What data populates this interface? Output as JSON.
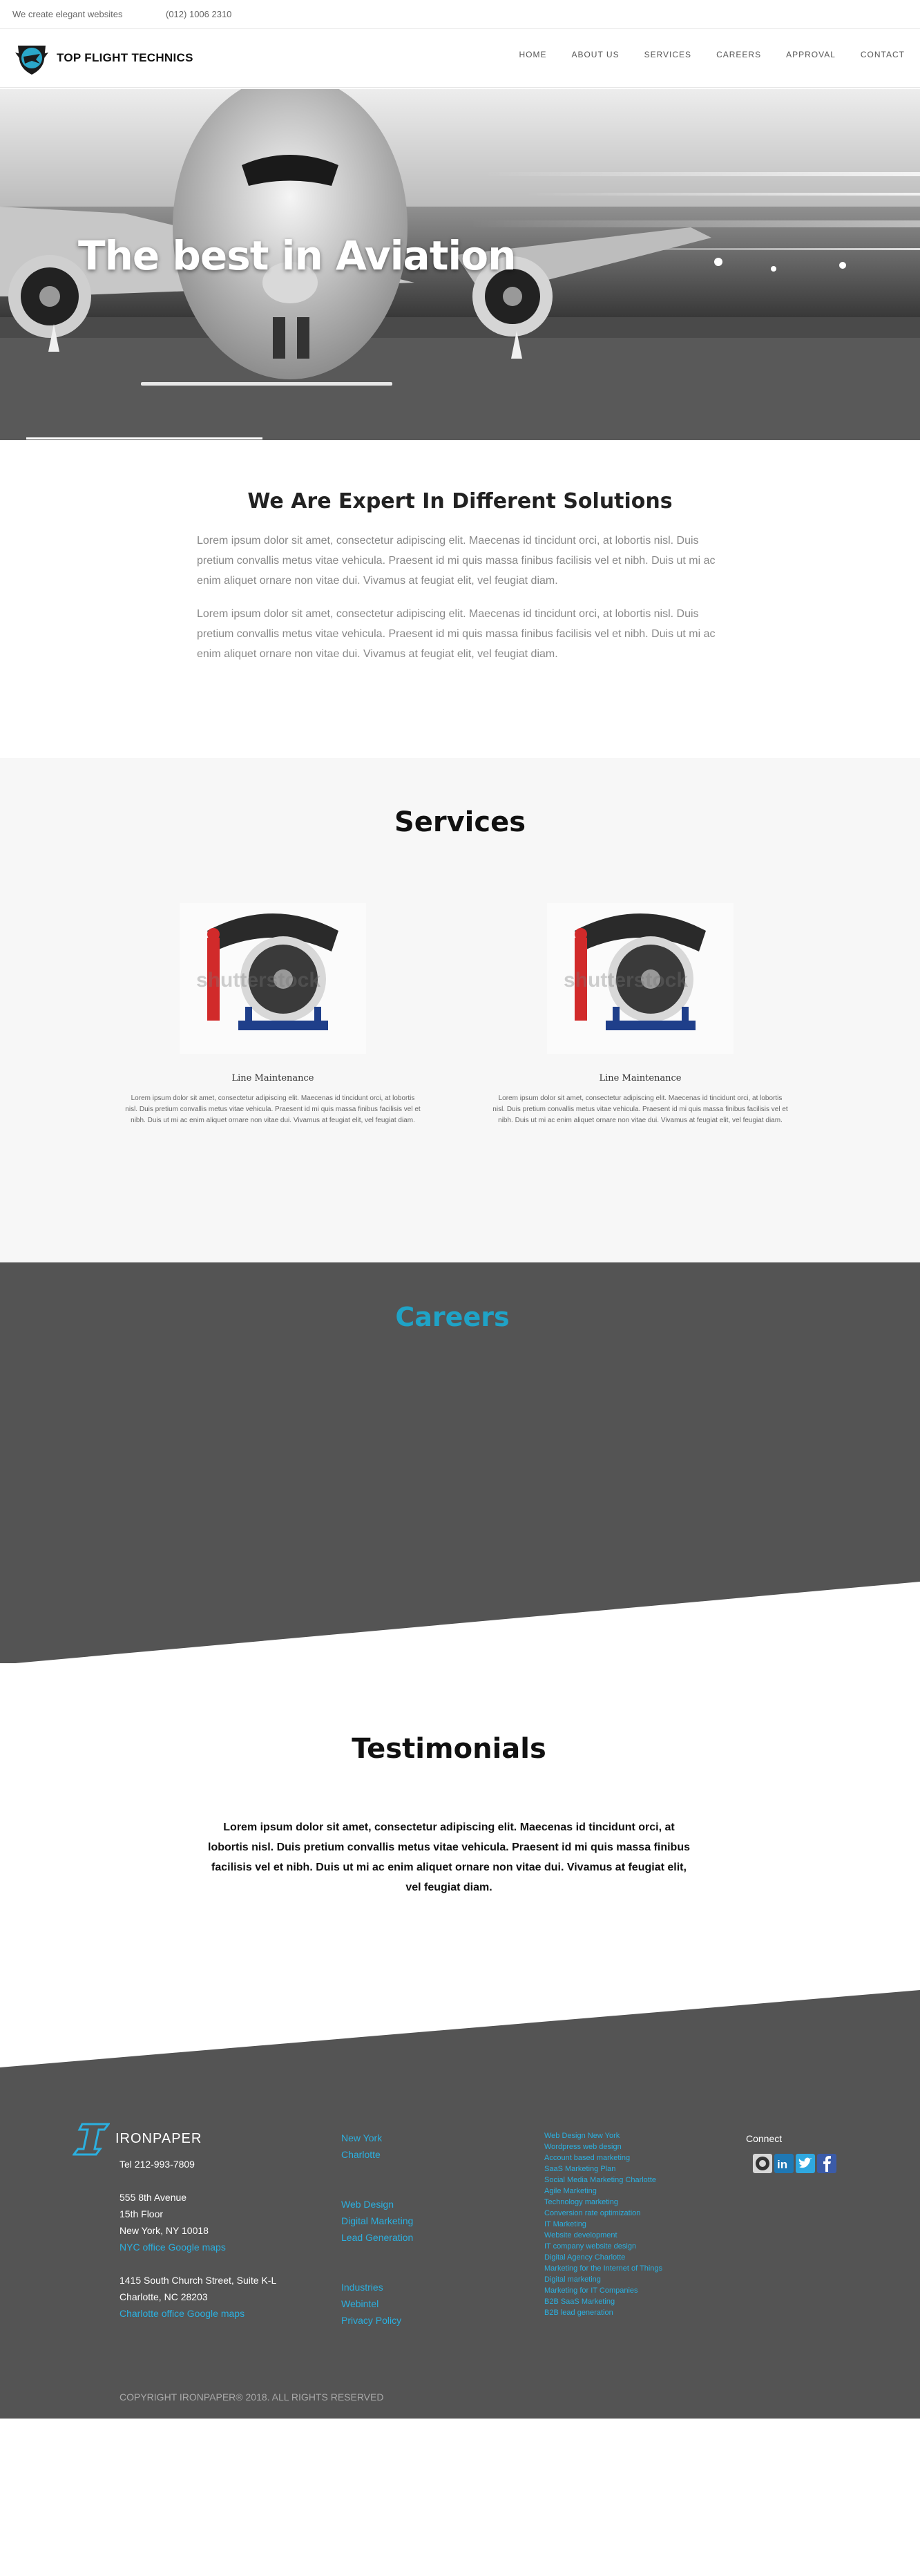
{
  "topbar": {
    "tagline": "We create elegant websites",
    "phone": "(012) 1006 2310"
  },
  "brand": {
    "name": "TOP FLIGHT TECHNICS"
  },
  "nav": {
    "items": [
      "HOME",
      "ABOUT US",
      "SERVICES",
      "CAREERS",
      "APPROVAL",
      "CONTACT"
    ]
  },
  "hero": {
    "title": "The best in Aviation"
  },
  "expert": {
    "title": "We Are Expert In Different Solutions",
    "paragraphs": [
      "Lorem ipsum dolor sit amet, consectetur adipiscing elit. Maecenas id tincidunt orci, at lobortis nisl. Duis pretium convallis metus vitae vehicula. Praesent id mi quis massa finibus facilisis vel et nibh. Duis ut mi ac enim aliquet ornare non vitae dui. Vivamus at feugiat elit, vel feugiat diam.",
      "Lorem ipsum dolor sit amet, consectetur adipiscing elit. Maecenas id tincidunt orci, at lobortis nisl. Duis pretium convallis metus vitae vehicula. Praesent id mi quis massa finibus facilisis vel et nibh. Duis ut mi ac enim aliquet ornare non vitae dui. Vivamus at feugiat elit, vel feugiat diam."
    ]
  },
  "services": {
    "title": "Services",
    "cards": [
      {
        "title": "Line Maintenance",
        "text": "Lorem ipsum dolor sit amet, consectetur adipiscing elit. Maecenas id tincidunt orci, at lobortis nisl. Duis pretium convallis metus vitae vehicula. Praesent id mi quis massa finibus facilisis vel et nibh. Duis ut mi ac enim aliquet ornare non vitae dui. Vivamus at feugiat elit, vel feugiat diam."
      },
      {
        "title": "Line Maintenance",
        "text": "Lorem ipsum dolor sit amet, consectetur adipiscing elit. Maecenas id tincidunt orci, at lobortis nisl. Duis pretium convallis metus vitae vehicula. Praesent id mi quis massa finibus facilisis vel et nibh. Duis ut mi ac enim aliquet ornare non vitae dui. Vivamus at feugiat elit, vel feugiat diam."
      }
    ],
    "watermark": "shutterstock"
  },
  "careers": {
    "title": "Careers"
  },
  "testimonials": {
    "title": "Testimonials",
    "text": "Lorem ipsum dolor sit amet, consectetur adipiscing elit. Maecenas id tincidunt orci, at lobortis nisl. Duis pretium convallis metus vitae vehicula. Praesent id mi quis massa finibus facilisis vel et nibh. Duis ut mi ac enim aliquet ornare non vitae dui. Vivamus at feugiat elit, vel feugiat diam."
  },
  "footer": {
    "brand": "IRONPAPER",
    "tel": "Tel 212-993-7809",
    "ny_address": [
      "555 8th Avenue",
      "15th Floor",
      "New York, NY 10018"
    ],
    "ny_map": "NYC office Google maps",
    "nc_address": [
      "1415 South Church Street, Suite K-L",
      "Charlotte, NC 28203"
    ],
    "nc_map": "Charlotte office Google maps",
    "locations": [
      "New York",
      "Charlotte"
    ],
    "services": [
      "Web Design",
      "Digital Marketing",
      "Lead Generation"
    ],
    "more": [
      "Industries",
      "Webintel",
      "Privacy Policy"
    ],
    "links": [
      "Web Design New York",
      "Wordpress web design",
      "Account based marketing",
      "SaaS Marketing Plan",
      "Social Media Marketing Charlotte",
      "Agile Marketing",
      "Technology marketing",
      "Conversion rate optimization",
      "IT Marketing",
      "Website development",
      "IT company website design",
      "Digital Agency Charlotte",
      "Marketing for the Internet of Things",
      "Digital marketing",
      "Marketing for IT Companies",
      "B2B SaaS Marketing",
      "B2B lead generation"
    ],
    "connect": "Connect",
    "social": [
      "mail-icon",
      "linkedin-icon",
      "twitter-icon",
      "facebook-icon"
    ],
    "copyright": "COPYRIGHT IRONPAPER® 2018. ALL RIGHTS RESERVED"
  },
  "colors": {
    "accent": "#1fa3c7",
    "link": "#2bb0e0",
    "dark": "#545454",
    "light_bg": "#f7f7f7"
  }
}
